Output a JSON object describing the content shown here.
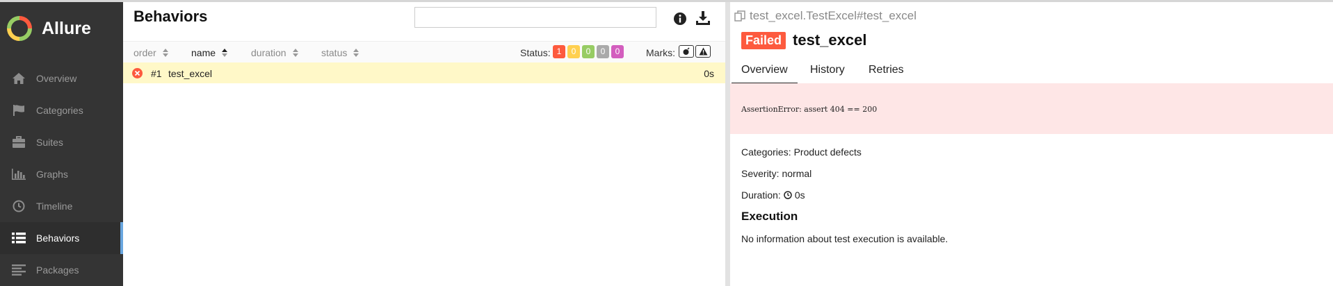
{
  "app": {
    "name": "Allure"
  },
  "sidebar": {
    "items": [
      {
        "label": "Overview",
        "icon": "home-icon",
        "active": false
      },
      {
        "label": "Categories",
        "icon": "flag-icon",
        "active": false
      },
      {
        "label": "Suites",
        "icon": "briefcase-icon",
        "active": false
      },
      {
        "label": "Graphs",
        "icon": "bar-chart-icon",
        "active": false
      },
      {
        "label": "Timeline",
        "icon": "clock-icon",
        "active": false
      },
      {
        "label": "Behaviors",
        "icon": "list-icon",
        "active": true
      },
      {
        "label": "Packages",
        "icon": "align-left-icon",
        "active": false
      }
    ]
  },
  "behaviors": {
    "title": "Behaviors",
    "search": {
      "value": "",
      "placeholder": ""
    },
    "columns": {
      "order": "order",
      "name": "name",
      "duration": "duration",
      "status": "status"
    },
    "status_label": "Status:",
    "status_counts": [
      {
        "value": "1",
        "color": "#fd5a3e"
      },
      {
        "value": "0",
        "color": "#ffd050"
      },
      {
        "value": "0",
        "color": "#97cc64"
      },
      {
        "value": "0",
        "color": "#aaaaaa"
      },
      {
        "value": "0",
        "color": "#d35ebe"
      }
    ],
    "marks_label": "Marks:",
    "rows": [
      {
        "order": "#1",
        "name": "test_excel",
        "duration": "0s",
        "status": "failed"
      }
    ]
  },
  "details": {
    "path": "test_excel.TestExcel#test_excel",
    "status_badge": "Failed",
    "title": "test_excel",
    "tabs": [
      "Overview",
      "History",
      "Retries"
    ],
    "active_tab": "Overview",
    "error_message": "AssertionError: assert 404 == 200",
    "categories_label": "Categories:",
    "categories_value": "Product defects",
    "severity_label": "Severity:",
    "severity_value": "normal",
    "duration_label": "Duration:",
    "duration_value": "0s",
    "execution_title": "Execution",
    "execution_text": "No information about test execution is available."
  },
  "colors": {
    "sidebar_bg": "#343434",
    "accent": "#69a6de",
    "failed": "#fd5a3e",
    "error_bg": "#fee6e6",
    "selected_row": "#fff8c8"
  }
}
